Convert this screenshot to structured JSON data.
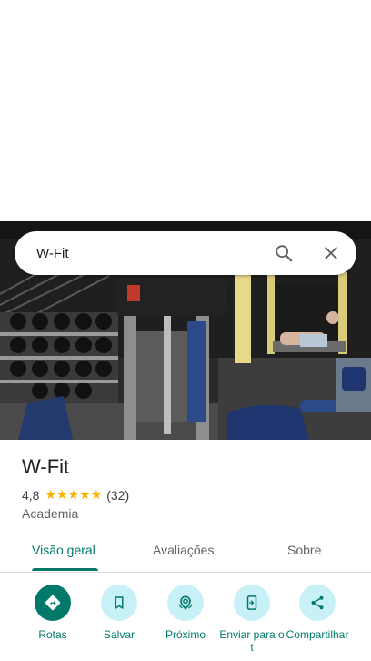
{
  "search": {
    "query": "W-Fit"
  },
  "place": {
    "name": "W-Fit",
    "rating": "4,8",
    "stars": "★★★★★",
    "review_count": "(32)",
    "category": "Academia"
  },
  "tabs": [
    {
      "label": "Visão geral",
      "active": true
    },
    {
      "label": "Avaliações",
      "active": false
    },
    {
      "label": "Sobre",
      "active": false
    }
  ],
  "actions": [
    {
      "label": "Rotas",
      "icon": "directions-icon"
    },
    {
      "label": "Salvar",
      "icon": "bookmark-icon"
    },
    {
      "label": "Próximo",
      "icon": "nearby-icon"
    },
    {
      "label": "Enviar para o t",
      "icon": "send-to-phone-icon"
    },
    {
      "label": "Compartilhar",
      "icon": "share-icon"
    }
  ],
  "colors": {
    "accent": "#00796b",
    "action_bg": "#c8f0f7",
    "stars": "#f5b400"
  }
}
